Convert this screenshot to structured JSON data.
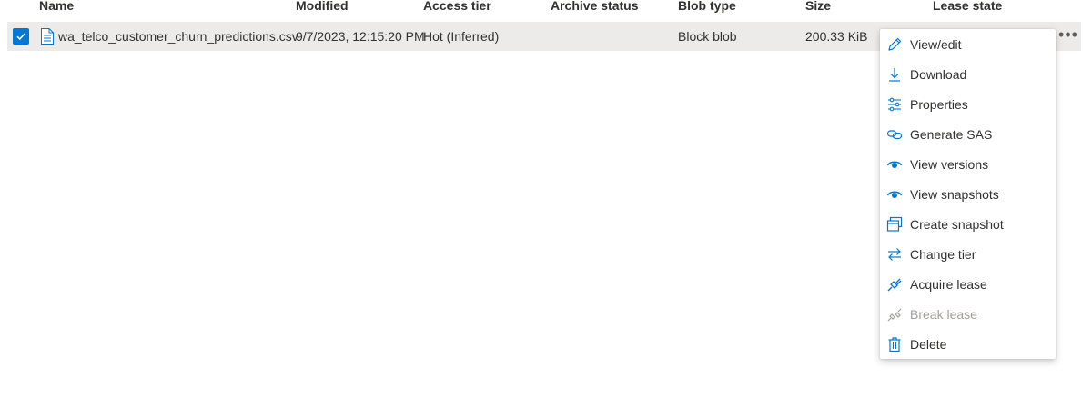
{
  "table": {
    "columns": [
      "Name",
      "Modified",
      "Access tier",
      "Archive status",
      "Blob type",
      "Size",
      "Lease state"
    ],
    "rows": [
      {
        "selected": true,
        "name": "wa_telco_customer_churn_predictions.csv",
        "modified": "9/7/2023, 12:15:20 PM",
        "access_tier": "Hot (Inferred)",
        "archive_status": "",
        "blob_type": "Block blob",
        "size": "200.33 KiB",
        "lease_state": ""
      }
    ],
    "more_label": "•••"
  },
  "context_menu": {
    "items": [
      {
        "label": "View/edit",
        "icon": "pencil-icon",
        "enabled": true
      },
      {
        "label": "Download",
        "icon": "download-icon",
        "enabled": true
      },
      {
        "label": "Properties",
        "icon": "properties-icon",
        "enabled": true
      },
      {
        "label": "Generate SAS",
        "icon": "link-icon",
        "enabled": true
      },
      {
        "label": "View versions",
        "icon": "eye-icon",
        "enabled": true
      },
      {
        "label": "View snapshots",
        "icon": "eye-icon",
        "enabled": true
      },
      {
        "label": "Create snapshot",
        "icon": "snapshot-icon",
        "enabled": true
      },
      {
        "label": "Change tier",
        "icon": "swap-arrows-icon",
        "enabled": true
      },
      {
        "label": "Acquire lease",
        "icon": "plug-icon",
        "enabled": true
      },
      {
        "label": "Break lease",
        "icon": "broken-plug-icon",
        "enabled": false
      },
      {
        "label": "Delete",
        "icon": "trash-icon",
        "enabled": true
      }
    ]
  },
  "colors": {
    "accent": "#0078d4",
    "selected_row": "#edebe9",
    "disabled_text": "#a19f9d"
  }
}
